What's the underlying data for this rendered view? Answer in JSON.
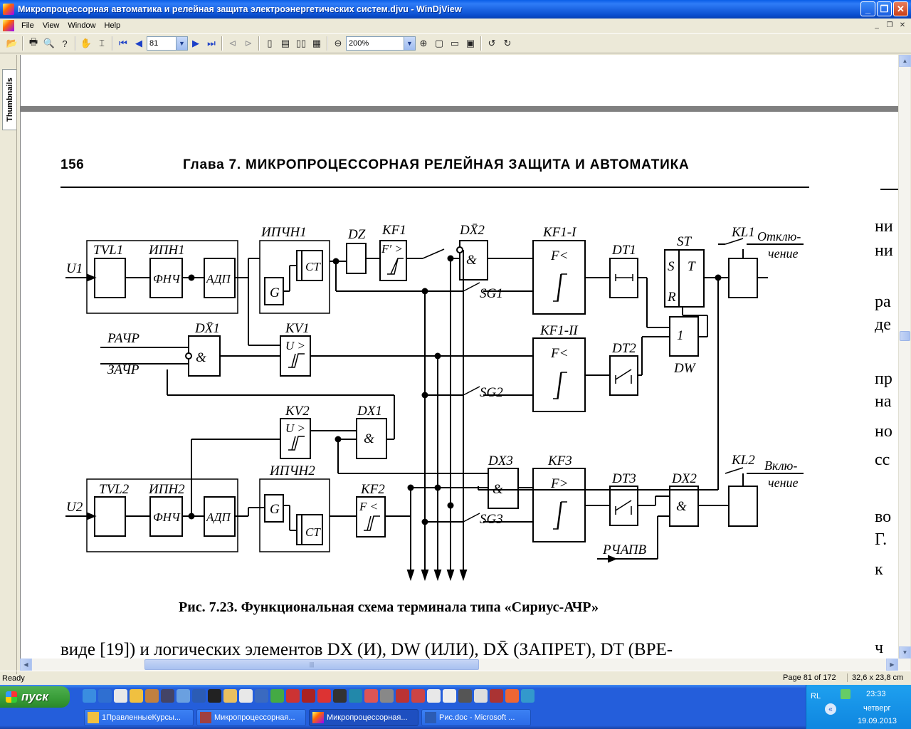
{
  "window": {
    "title": "Микропроцессорная автоматика и релейная защита электроэнергетических систем.djvu - WinDjView"
  },
  "menu": {
    "items": [
      "File",
      "View",
      "Window",
      "Help"
    ]
  },
  "toolbar": {
    "page_value": "81",
    "zoom_value": "200%"
  },
  "sidebar": {
    "tab_label": "Thumbnails"
  },
  "document": {
    "page_number": "156",
    "chapter_header": "Глава 7.  МИКРОПРОЦЕССОРНАЯ РЕЛЕЙНАЯ ЗАЩИТА И АВТОМАТИКА",
    "figure_caption": "Рис. 7.23. Функциональная схема терминала типа «Сириус-АЧР»",
    "body_text": "виде [19]) и логических элементов DX (И), DW (ИЛИ), DX̄  (ЗАПРЕТ), DT (ВРЕ-",
    "right_fragments": [
      "ни",
      "ни",
      "ра",
      "де",
      "пр",
      "на",
      "но",
      "сс",
      "во",
      "Г.",
      "к",
      "ч"
    ],
    "diagram": {
      "inputs": [
        "U1",
        "U2",
        "РАЧР",
        "ЗАЧР",
        "РЧАПВ"
      ],
      "blocks": {
        "tvl1": "TVL1",
        "ipn1": "ИПН1",
        "fnch1": "ФНЧ",
        "adp1": "АДП",
        "ipchn1": "ИПЧН1",
        "g1": "G",
        "ct1": "CT",
        "dz": "DZ",
        "kf1": "KF1",
        "kf1_sym": "F′ >",
        "dx2_top": "DX̄2",
        "and": "&",
        "kf1_i": "KF1-I",
        "f_less": "F<",
        "dt1": "DT1",
        "st": "ST",
        "st_s": "S",
        "st_t": "T",
        "st_r": "R",
        "kl1": "KL1",
        "out1_a": "Отклю-",
        "out1_b": "чение",
        "sg1": "SG1",
        "dx1_top": "DX̄1",
        "kv1": "KV1",
        "u_more": "U >",
        "kf1_ii": "KF1-II",
        "dt2": "DT2",
        "dw": "DW",
        "dw_sym": "1",
        "sg2": "SG2",
        "kv2": "KV2",
        "dx1": "DX1",
        "tvl2": "TVL2",
        "ipn2": "ИПН2",
        "fnch2": "ФНЧ",
        "adp2": "АДП",
        "ipchn2": "ИПЧН2",
        "g2": "G",
        "ct2": "CT",
        "kf2": "KF2",
        "kf2_sym": "F <",
        "dx3": "DX3",
        "kf3": "KF3",
        "f_more": "F>",
        "dt3": "DT3",
        "dx2": "DX2",
        "kl2": "KL2",
        "out2_a": "Вклю-",
        "out2_b": "чение",
        "sg3": "SG3"
      }
    }
  },
  "status": {
    "ready": "Ready",
    "page_info": "Page 81 of 172",
    "page_size": "32,6 x 23,8 cm"
  },
  "taskbar": {
    "start_label": "пуск",
    "tasks": [
      "1ПравленныеКурсы...",
      "Микропроцессорная...",
      "Микропроцессорная...",
      "Рис.doc - Microsoft ..."
    ],
    "lang": "RL",
    "time": "23:33",
    "day": "четверг",
    "date": "19.09.2013"
  }
}
